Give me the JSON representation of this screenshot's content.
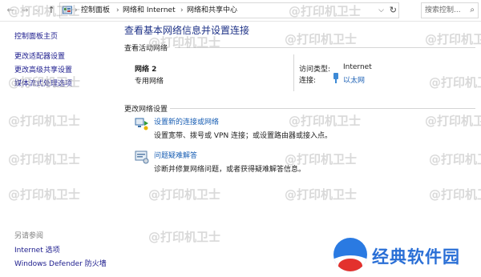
{
  "address_bar": {
    "back_icon": "arrow-left-icon",
    "forward_icon": "arrow-right-icon",
    "recent_icon": "chevron-down-icon",
    "up_icon": "arrow-up-icon",
    "breadcrumbs": [
      "控制面板",
      "网络和 Internet",
      "网络和共享中心"
    ],
    "search_placeholder": "搜索控制..."
  },
  "sidebar": {
    "home": "控制面板主页",
    "links": [
      "更改适配器设置",
      "更改高级共享设置",
      "媒体流式处理选项"
    ],
    "see_also_title": "另请参阅",
    "see_also_links": [
      "Internet 选项",
      "Windows Defender 防火墙"
    ]
  },
  "main": {
    "title": "查看基本网络信息并设置连接",
    "active_networks_header": "查看活动网络",
    "network": {
      "name": "网络 2",
      "type": "专用网络",
      "access_type_label": "访问类型:",
      "access_type_value": "Internet",
      "connection_label": "连接:",
      "connection_value": "以太网"
    },
    "change_settings_header": "更改网络设置",
    "tasks": [
      {
        "link": "设置新的连接或网络",
        "desc": "设置宽带、拨号或 VPN 连接；或设置路由器或接入点。"
      },
      {
        "link": "问题疑难解答",
        "desc": "诊断并修复网络问题，或者获得疑难解答信息。"
      }
    ]
  },
  "watermark": "@打印机卫士",
  "brand_logo": "经典软件园",
  "colors": {
    "link": "#1a1a8c",
    "title": "#1e3287",
    "logo": "#2a7ae2"
  }
}
